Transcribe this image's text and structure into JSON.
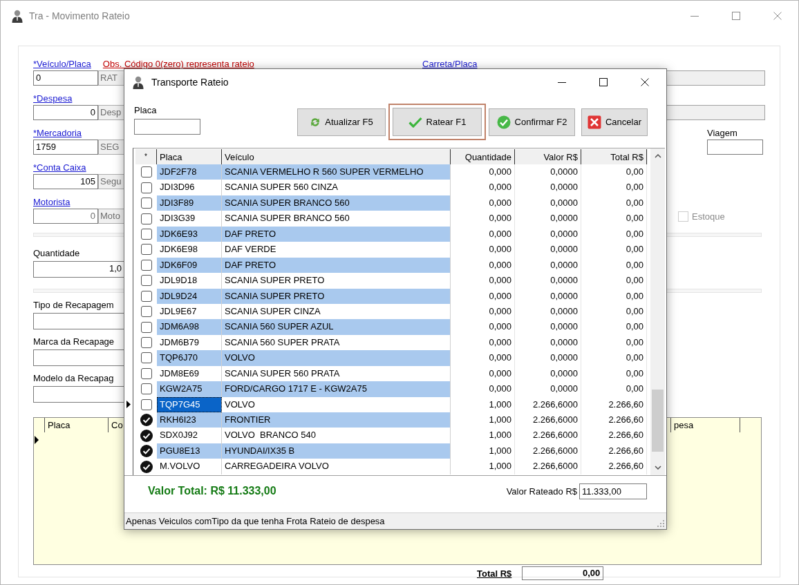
{
  "window": {
    "title": "Tra - Movimento Rateio"
  },
  "form": {
    "note": "Obs. Código 0(zero) representa rateio",
    "fields": [
      {
        "label": "*Veículo/Placa",
        "kind": "text",
        "value": "0",
        "description": "RAT",
        "disabled": false
      },
      {
        "label": "*Despesa",
        "kind": "number",
        "value": "0",
        "description": "Desp",
        "disabled": false
      },
      {
        "label": "*Mercadoria",
        "kind": "text",
        "value": "1759",
        "description": "SEG",
        "disabled": false
      },
      {
        "label": "*Conta Caixa",
        "kind": "number",
        "value": "105",
        "description": "Segu",
        "disabled": false
      },
      {
        "label": "Motorista",
        "kind": "number",
        "value": "0",
        "description": "Moto",
        "disabled": true
      }
    ],
    "carreta_label": "Carreta/Placa",
    "viagem_label": "Viagem",
    "estoque": {
      "label": "Estoque",
      "checked": false,
      "disabled": true
    },
    "quantidade": {
      "label": "Quantidade",
      "value": "1,0"
    },
    "recapagem_fields": [
      {
        "label": "Tipo de Recapagem"
      },
      {
        "label": "Marca da Recapage"
      },
      {
        "label": "Modelo da Recapag"
      }
    ],
    "grid": {
      "columns": [
        "Placa",
        "Co",
        "pesa"
      ]
    },
    "total": {
      "label": "Total R$",
      "value": "0,00"
    }
  },
  "dialog": {
    "title": "Transporte Rateio",
    "placa_label": "Placa",
    "buttons": [
      {
        "label": "Atualizar F5",
        "kind": "refresh",
        "focused": false
      },
      {
        "label": "Ratear F1",
        "kind": "check",
        "focused": true
      },
      {
        "label": "Confirmar F2",
        "kind": "confirm",
        "focused": false
      },
      {
        "label": "Cancelar",
        "kind": "cancel",
        "focused": false
      }
    ],
    "table": {
      "columns": [
        "*",
        "Placa",
        "Veículo",
        "Quantidade",
        "Valor R$",
        "Total R$"
      ],
      "rows": [
        {
          "placa": "JDF2F78",
          "veiculo": "SCANIA VERMELHO R 560 SUPER VERMELHO",
          "quantidade": "0,000",
          "valor": "0,0000",
          "total": "0,00",
          "checked": false,
          "selected": false
        },
        {
          "placa": "JDI3D96",
          "veiculo": "SCANIA SUPER 560 CINZA",
          "quantidade": "0,000",
          "valor": "0,0000",
          "total": "0,00",
          "checked": false,
          "selected": false
        },
        {
          "placa": "JDI3F89",
          "veiculo": "SCANIA SUPER BRANCO 560",
          "quantidade": "0,000",
          "valor": "0,0000",
          "total": "0,00",
          "checked": false,
          "selected": false
        },
        {
          "placa": "JDI3G39",
          "veiculo": "SCANIA SUPER BRANCO 560",
          "quantidade": "0,000",
          "valor": "0,0000",
          "total": "0,00",
          "checked": false,
          "selected": false
        },
        {
          "placa": "JDK6E93",
          "veiculo": "DAF PRETO",
          "quantidade": "0,000",
          "valor": "0,0000",
          "total": "0,00",
          "checked": false,
          "selected": false
        },
        {
          "placa": "JDK6E98",
          "veiculo": "DAF VERDE",
          "quantidade": "0,000",
          "valor": "0,0000",
          "total": "0,00",
          "checked": false,
          "selected": false
        },
        {
          "placa": "JDK6F09",
          "veiculo": "DAF PRETO",
          "quantidade": "0,000",
          "valor": "0,0000",
          "total": "0,00",
          "checked": false,
          "selected": false
        },
        {
          "placa": "JDL9D18",
          "veiculo": "SCANIA SUPER PRETO",
          "quantidade": "0,000",
          "valor": "0,0000",
          "total": "0,00",
          "checked": false,
          "selected": false
        },
        {
          "placa": "JDL9D24",
          "veiculo": "SCANIA SUPER PRETO",
          "quantidade": "0,000",
          "valor": "0,0000",
          "total": "0,00",
          "checked": false,
          "selected": false
        },
        {
          "placa": "JDL9E67",
          "veiculo": "SCANIA SUPER CINZA",
          "quantidade": "0,000",
          "valor": "0,0000",
          "total": "0,00",
          "checked": false,
          "selected": false
        },
        {
          "placa": "JDM6A98",
          "veiculo": "SCANIA 560 SUPER AZUL",
          "quantidade": "0,000",
          "valor": "0,0000",
          "total": "0,00",
          "checked": false,
          "selected": false
        },
        {
          "placa": "JDM6B79",
          "veiculo": "SCANIA 560 SUPER PRATA",
          "quantidade": "0,000",
          "valor": "0,0000",
          "total": "0,00",
          "checked": false,
          "selected": false
        },
        {
          "placa": "TQP6J70",
          "veiculo": "VOLVO",
          "quantidade": "0,000",
          "valor": "0,0000",
          "total": "0,00",
          "checked": false,
          "selected": false
        },
        {
          "placa": "JDM8E69",
          "veiculo": "SCANIA SUPER 560 PRATA",
          "quantidade": "0,000",
          "valor": "0,0000",
          "total": "0,00",
          "checked": false,
          "selected": false
        },
        {
          "placa": "KGW2A75",
          "veiculo": "FORD/CARGO 1717 E - KGW2A75",
          "quantidade": "0,000",
          "valor": "0,0000",
          "total": "0,00",
          "checked": false,
          "selected": false
        },
        {
          "placa": "TQP7G45",
          "veiculo": "VOLVO",
          "quantidade": "1,000",
          "valor": "2.266,6000",
          "total": "2.266,60",
          "checked": false,
          "selected": true
        },
        {
          "placa": "RKH6I23",
          "veiculo": "FRONTIER",
          "quantidade": "1,000",
          "valor": "2.266,6000",
          "total": "2.266,60",
          "checked": true,
          "selected": false
        },
        {
          "placa": "SDX0J92",
          "veiculo": "VOLVO  BRANCO 540",
          "quantidade": "1,000",
          "valor": "2.266,6000",
          "total": "2.266,60",
          "checked": true,
          "selected": false
        },
        {
          "placa": "PGU8E13",
          "veiculo": "HYUNDAI/IX35 B",
          "quantidade": "1,000",
          "valor": "2.266,6000",
          "total": "2.266,60",
          "checked": true,
          "selected": false
        },
        {
          "placa": "M.VOLVO",
          "veiculo": "CARREGADEIRA VOLVO",
          "quantidade": "1,000",
          "valor": "2.266,6000",
          "total": "2.266,60",
          "checked": true,
          "selected": false
        }
      ]
    },
    "valor_total": "Valor Total: R$ 11.333,00",
    "valor_rateado": {
      "label": "Valor Rateado R$",
      "value": "11.333,00"
    },
    "status_bar": "Apenas Veiculos comTipo da que tenha Frota Rateio de despesa"
  }
}
